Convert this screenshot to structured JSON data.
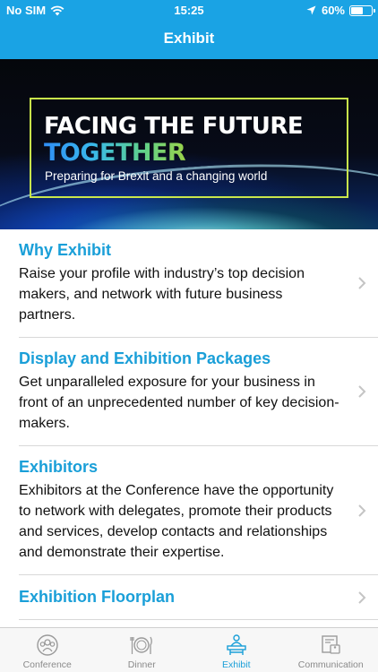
{
  "status_bar": {
    "carrier": "No SIM",
    "time": "15:25",
    "battery": "60%",
    "battery_level": 0.6
  },
  "nav": {
    "title": "Exhibit"
  },
  "banner": {
    "line1": "FACING THE FUTURE",
    "line2": "TOGETHER",
    "subtitle": "Preparing for Brexit and a changing world"
  },
  "items": [
    {
      "title": "Why Exhibit",
      "description": "Raise your profile with industry’s top decision makers, and network with future business partners."
    },
    {
      "title": "Display and Exhibition Packages",
      "description": "Get unparalleled exposure for your business in front of an unprecedented number of key decision-makers."
    },
    {
      "title": "Exhibitors",
      "description": "Exhibitors at the Conference have the opportunity to network with delegates, promote their products and services, develop contacts and relationships and demonstrate their expertise."
    },
    {
      "title": "Exhibition Floorplan",
      "description": ""
    }
  ],
  "tabs": [
    {
      "label": "Conference",
      "icon": "conference-icon",
      "active": false
    },
    {
      "label": "Dinner",
      "icon": "dinner-icon",
      "active": false
    },
    {
      "label": "Exhibit",
      "icon": "exhibit-icon",
      "active": true
    },
    {
      "label": "Communication",
      "icon": "communication-icon",
      "active": false
    }
  ],
  "colors": {
    "accent": "#1aa3e4",
    "link": "#1a9fd8",
    "tab_inactive": "#8a8a8a",
    "banner_frame": "#c9e64b"
  }
}
